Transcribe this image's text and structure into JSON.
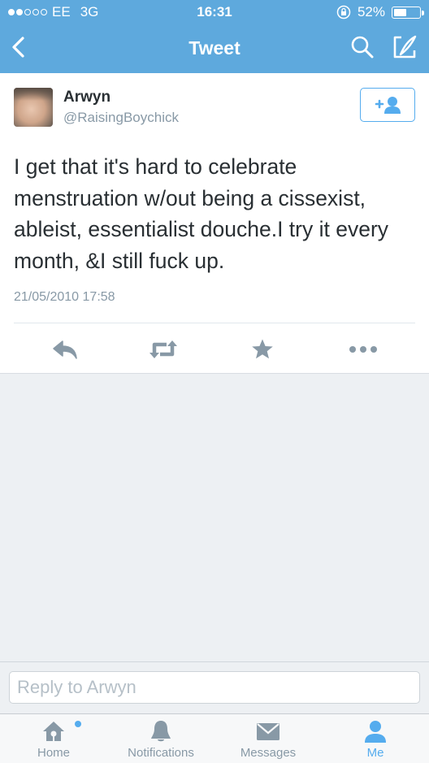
{
  "status_bar": {
    "carrier": "EE",
    "network": "3G",
    "time": "16:31",
    "battery": "52%",
    "battery_level": 0.52
  },
  "nav": {
    "title": "Tweet"
  },
  "tweet": {
    "name": "Arwyn",
    "handle": "@RaisingBoychick",
    "text": "I get that it's hard to celebrate menstruation w/out being a cissexist, ableist, essentialist douche.I try it every month, &I still fuck up.",
    "timestamp": "21/05/2010 17:58"
  },
  "reply": {
    "placeholder": "Reply to Arwyn"
  },
  "tabs": [
    {
      "label": "Home",
      "icon": "home-icon"
    },
    {
      "label": "Notifications",
      "icon": "bell-icon"
    },
    {
      "label": "Messages",
      "icon": "envelope-icon"
    },
    {
      "label": "Me",
      "icon": "person-icon"
    }
  ],
  "colors": {
    "accent": "#55acee",
    "header": "#5ea9dd",
    "muted": "#8899a6"
  }
}
